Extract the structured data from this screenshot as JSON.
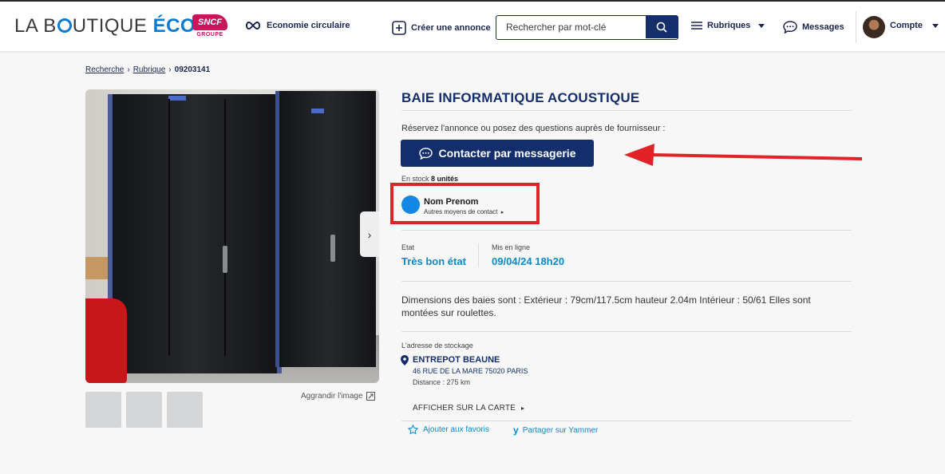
{
  "header": {
    "logo_prefix": "LA B",
    "logo_suffix": "UTIQUE",
    "logo_accent": "ÉCO",
    "partner_logo": "SNCF",
    "partner_sub": "GROUPE",
    "eco_label": "Economie circulaire",
    "create_label": "Créer une annonce",
    "search_placeholder": "Rechercher par mot-clé",
    "rubriques_label": "Rubriques",
    "messages_label": "Messages",
    "account_label": "Compte"
  },
  "breadcrumb": {
    "items": [
      "Recherche",
      "Rubrique"
    ],
    "current": "09203141"
  },
  "gallery": {
    "enlarge_label": "Aggrandir l'image"
  },
  "listing": {
    "title": "BAIE INFORMATIQUE ACOUSTIQUE",
    "reserve_text": "Réservez l'annonce ou posez des questions auprès de fournisseur :",
    "contact_button": "Contacter par messagerie",
    "stock_prefix": "En stock",
    "stock_value": "8 unités",
    "seller_name": "Nom Prenom",
    "seller_link": "Autres moyens de contact",
    "state_label": "Etat",
    "state_value": "Très bon état",
    "online_label": "Mis en ligne",
    "online_value": "09/04/24 18h20",
    "description": "Dimensions des baies sont : Extérieur : 79cm/117.5cm hauteur 2.04m Intérieur : 50/61 Elles sont montées sur roulettes.",
    "address_label": "L'adresse de stockage",
    "address_name": "ENTREPOT BEAUNE",
    "address_street": "46 RUE DE LA MARE 75020 PARIS",
    "address_distance": "Distance : 275 km",
    "map_link": "AFFICHER SUR LA CARTE",
    "favorite_label": "Ajouter aux favoris",
    "yammer_label": "Partager sur Yammer"
  },
  "colors": {
    "navy": "#142e6b",
    "accent_blue": "#0b8ac9",
    "annotation_red": "#e12227"
  },
  "icons": [
    "infinity-icon",
    "plus-square-icon",
    "search-icon",
    "menu-icon",
    "chat-icon",
    "caret-down-icon",
    "chevron-right-icon",
    "expand-icon",
    "pin-icon",
    "star-icon",
    "yammer-icon"
  ]
}
